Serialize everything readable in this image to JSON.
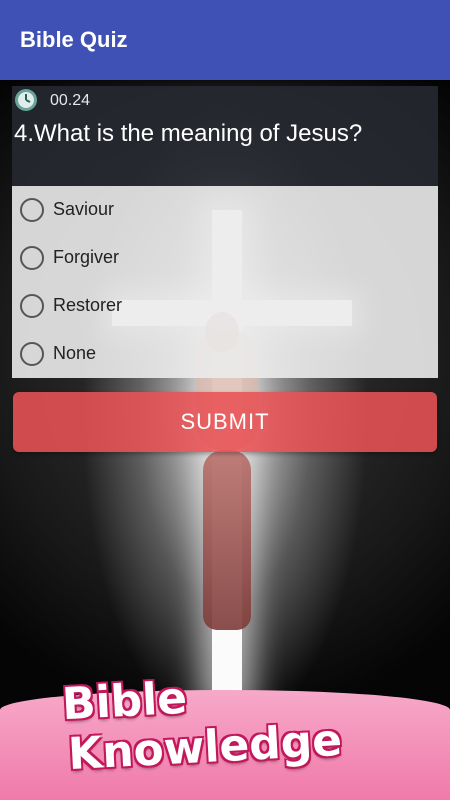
{
  "appbar": {
    "title": "Bible Quiz",
    "color": "#3f51b5"
  },
  "quiz": {
    "timer": "00.24",
    "timer_icon": "clock-icon",
    "question": "4.What is the meaning of Jesus?",
    "options": [
      "Saviour",
      "Forgiver",
      "Restorer",
      "None"
    ],
    "submit_label": "SUBMIT",
    "submit_color": "#e85254"
  },
  "promo": {
    "line1": "Bible",
    "line2": "Knowledge"
  }
}
